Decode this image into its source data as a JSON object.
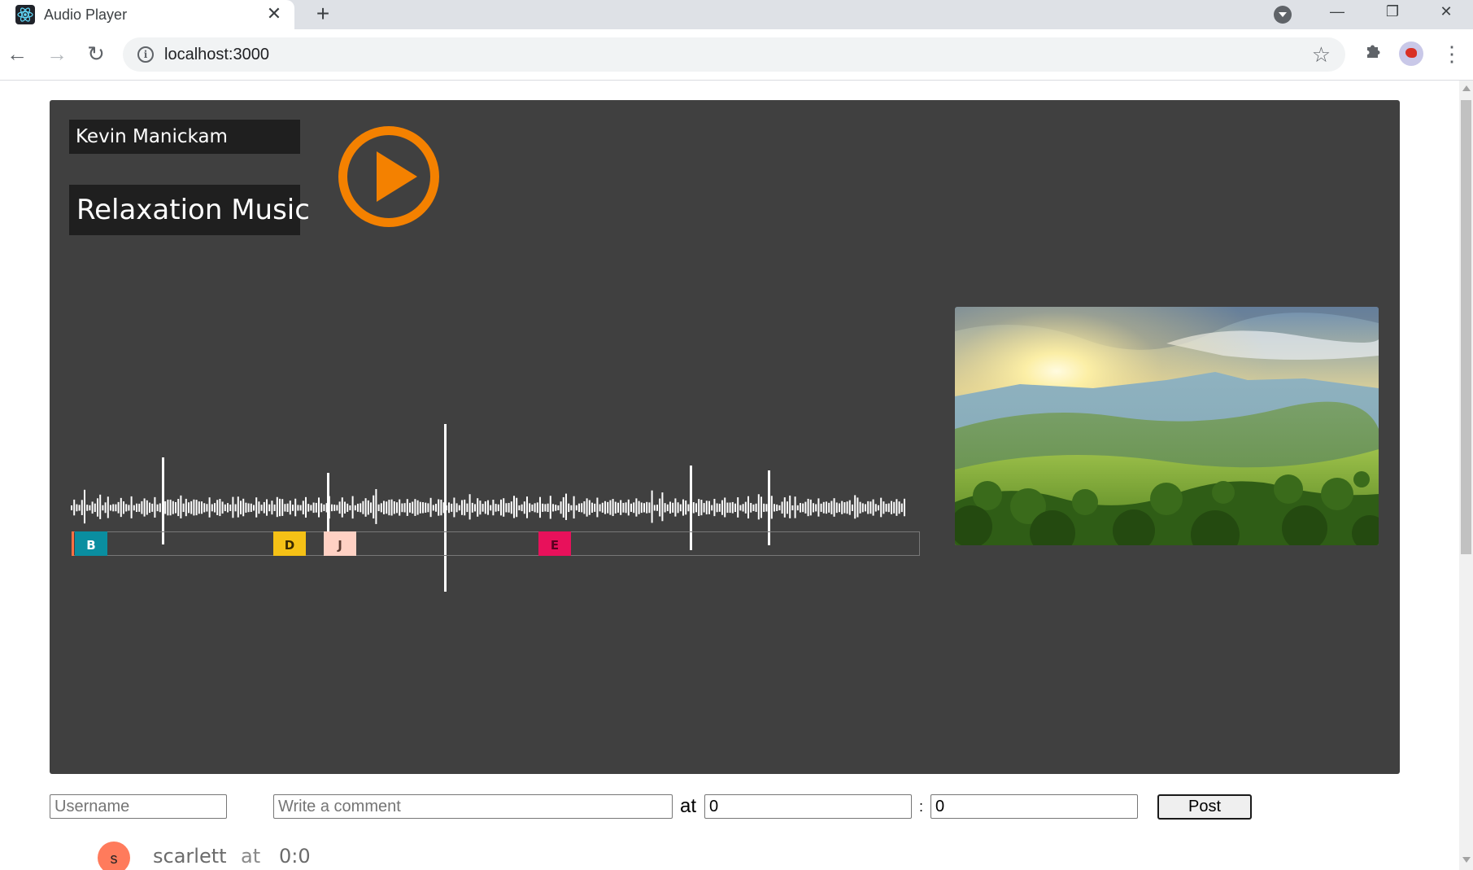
{
  "browser": {
    "tab_title": "Audio Player",
    "tab_close": "✕",
    "new_tab": "+",
    "url": "localhost:3000",
    "window_controls": {
      "minimize": "—",
      "restore": "❐",
      "close": "✕"
    },
    "nav": {
      "back": "←",
      "forward": "→",
      "reload": "↻"
    },
    "icons": {
      "star": "☆",
      "extensions": "⚙",
      "menu": "⋮",
      "info": "i"
    }
  },
  "player": {
    "artist": "Kevin Manickam",
    "track": "Relaxation Music",
    "play_icon": "play-icon",
    "accent_color": "#f48100",
    "background_color": "#404040",
    "markers": [
      {
        "letter": "B",
        "color": "#0a8ea0",
        "text_color": "#ffffff"
      },
      {
        "letter": "D",
        "color": "#f5c116",
        "text_color": "#3a2a00"
      },
      {
        "letter": "J",
        "color": "#ffd1c4",
        "text_color": "#5a3a30"
      },
      {
        "letter": "E",
        "color": "#e8115b",
        "text_color": "#5a0020"
      }
    ]
  },
  "comment_form": {
    "username_placeholder": "Username",
    "comment_placeholder": "Write a comment",
    "at_label": "at",
    "minutes_value": "0",
    "colon": ":",
    "seconds_value": "0",
    "post_label": "Post"
  },
  "comments": [
    {
      "avatar_letter": "s",
      "username": "scarlett",
      "at": "at",
      "time": "0:0",
      "avatar_color": "#ff7b5c"
    }
  ]
}
